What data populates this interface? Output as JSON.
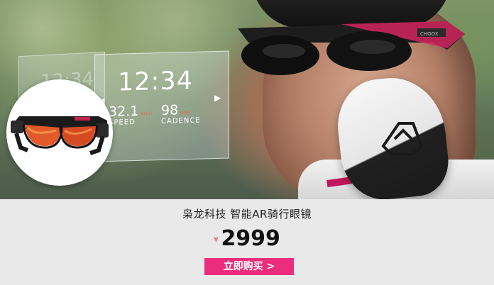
{
  "hud": {
    "ghost_time": "12:34",
    "time": "12:34",
    "speed_value": "32.1",
    "speed_unit": "KM/H",
    "speed_label": "SPEED",
    "cadence_value": "98",
    "cadence_unit": "RPM",
    "cadence_label": "CADENCE",
    "left_arrow": "◀",
    "right_arrow": "▶"
  },
  "product": {
    "title": "枭龙科技 智能AR骑行眼镜",
    "currency": "¥",
    "price": "2999",
    "buy_label": "立即购买 >"
  },
  "colors": {
    "accent": "#ec2c7d",
    "currency": "#e03a3a",
    "background": "#e9e9e9"
  },
  "icons": [
    "ar-glasses-icon",
    "glove-logo-icon",
    "product-glasses-icon"
  ]
}
